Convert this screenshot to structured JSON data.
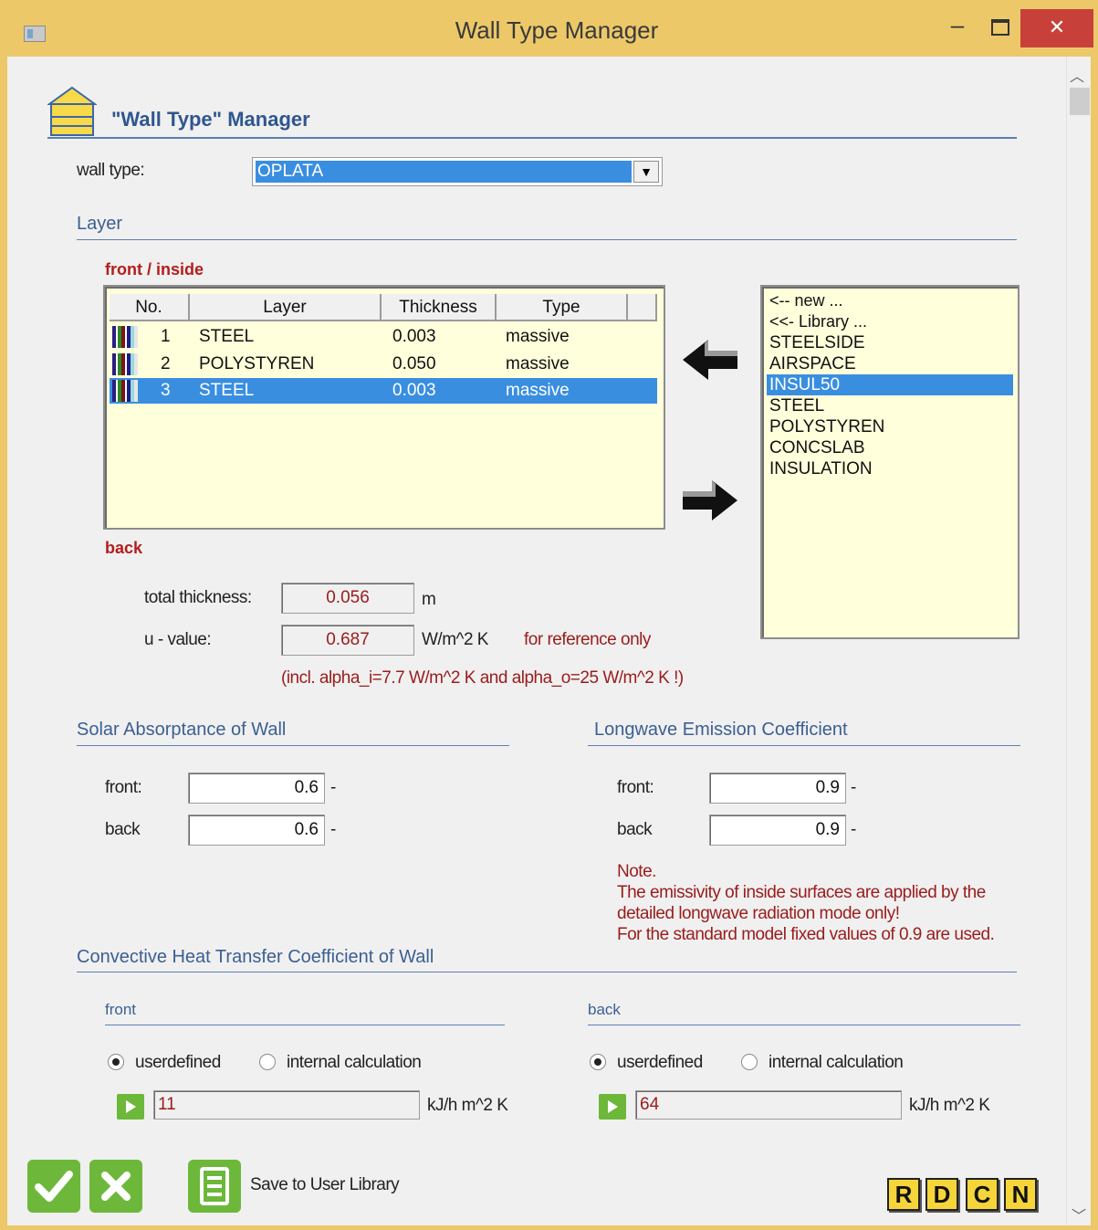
{
  "window": {
    "title": "Wall Type Manager",
    "minimize_glyph": "–",
    "close_glyph": "✕"
  },
  "header": {
    "title": "\"Wall Type\" Manager",
    "icon": "house-icon"
  },
  "wall_type": {
    "label": "wall type:",
    "value": "OPLATA"
  },
  "layer_section": {
    "title": "Layer",
    "front_label": "front / inside",
    "back_label": "back",
    "columns": [
      "No.",
      "Layer",
      "Thickness",
      "Type"
    ],
    "rows": [
      {
        "no": "1",
        "layer": "STEEL",
        "thickness": "0.003",
        "type": "massive",
        "selected": false
      },
      {
        "no": "2",
        "layer": "POLYSTYREN",
        "thickness": "0.050",
        "type": "massive",
        "selected": false
      },
      {
        "no": "3",
        "layer": "STEEL",
        "thickness": "0.003",
        "type": "massive",
        "selected": true
      }
    ]
  },
  "library": {
    "items": [
      "<-- new ...",
      "<<- Library ...",
      "STEELSIDE",
      "AIRSPACE",
      "INSUL50",
      "STEEL",
      "POLYSTYREN",
      "CONCSLAB",
      "INSULATION"
    ],
    "selected": "INSUL50"
  },
  "totals": {
    "thickness_label": "total thickness:",
    "thickness_value": "0.056",
    "thickness_unit": "m",
    "u_label": "u - value:",
    "u_value": "0.687",
    "u_unit": "W/m^2 K",
    "u_note": "for reference only",
    "u_incl_note": "(incl. alpha_i=7.7 W/m^2 K and alpha_o=25 W/m^2 K !)"
  },
  "solar": {
    "title": "Solar Absorptance of Wall",
    "front_label": "front:",
    "front_value": "0.6",
    "back_label": "back",
    "back_value": "0.6",
    "unit": "-"
  },
  "longwave": {
    "title": "Longwave Emission Coefficient",
    "front_label": "front:",
    "front_value": "0.9",
    "back_label": "back",
    "back_value": "0.9",
    "unit": "-",
    "note_lines": [
      "Note.",
      "The emissivity of inside surfaces are applied by the",
      "detailed longwave radiation mode only!",
      "For the standard model fixed values of 0.9 are used."
    ]
  },
  "convective": {
    "title": "Convective Heat Transfer Coefficient of Wall",
    "front": {
      "title": "front",
      "opt_user": "userdefined",
      "opt_internal": "internal calculation",
      "selected": "userdefined",
      "value": "11",
      "unit": "kJ/h m^2 K"
    },
    "back": {
      "title": "back",
      "opt_user": "userdefined",
      "opt_internal": "internal calculation",
      "selected": "userdefined",
      "value": "64",
      "unit": "kJ/h m^2 K"
    }
  },
  "footer": {
    "save_label": "Save to User Library",
    "letter_buttons": [
      "R",
      "D",
      "C",
      "N"
    ]
  },
  "colors": {
    "accent": "#3a8ee0",
    "section_blue": "#3b5f93",
    "warn_red": "#9a1c1c",
    "ok_green": "#6db83a",
    "list_bg": "#ffffdc",
    "titlebar": "#ecc869"
  }
}
